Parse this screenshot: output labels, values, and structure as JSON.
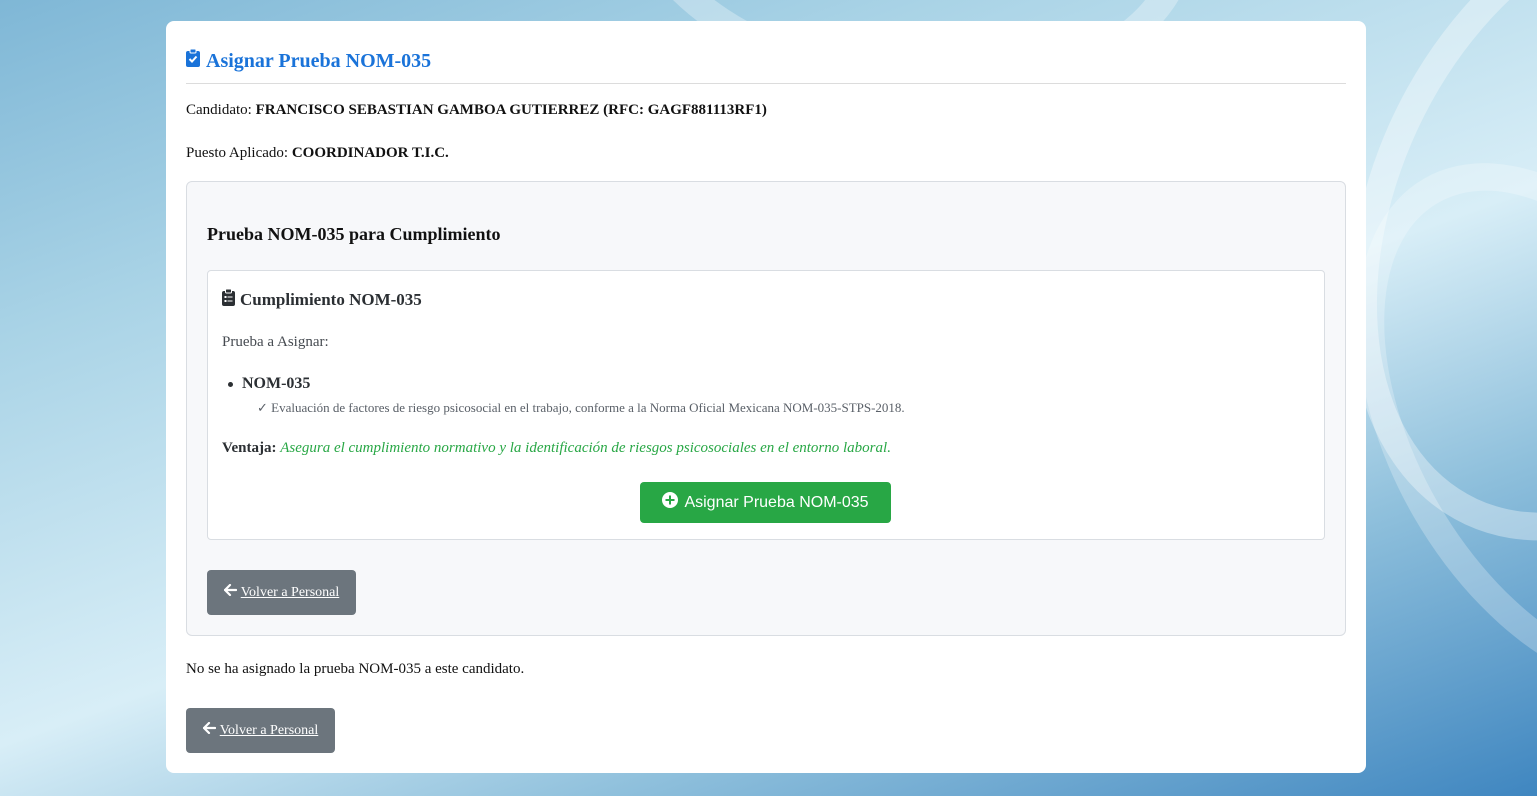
{
  "header": {
    "title": "Asignar Prueba NOM-035"
  },
  "candidate": {
    "label": "Candidato:",
    "value": "FRANCISCO SEBASTIAN GAMBOA GUTIERREZ (RFC: GAGF881113RF1)"
  },
  "position": {
    "label": "Puesto Aplicado:",
    "value": "COORDINADOR T.I.C."
  },
  "panel": {
    "heading": "Prueba NOM-035 para Cumplimiento",
    "card": {
      "title": "Cumplimiento NOM-035",
      "prompt": "Prueba a Asignar:",
      "test_name": "NOM-035",
      "test_desc": "✓ Evaluación de factores de riesgo psicosocial en el trabajo, conforme a la Norma Oficial Mexicana NOM-035-STPS-2018.",
      "advantage_label": "Ventaja:",
      "advantage_text": "Asegura el cumplimiento normativo y la identificación de riesgos psicosociales en el entorno laboral.",
      "assign_button": "Asignar Prueba NOM-035"
    },
    "back_button": "Volver a Personal"
  },
  "status_text": "No se ha asignado la prueba NOM-035 a este candidato.",
  "footer_back_button": "Volver a Personal",
  "colors": {
    "accent": "#1a73d9",
    "success": "#28a745",
    "advantage_text": "#28a745",
    "secondary_button": "#6c757d"
  },
  "icons": {
    "title_icon": "clipboard-check-icon",
    "card_icon": "clipboard-list-icon",
    "assign_icon": "plus-circle-icon",
    "back_icon": "arrow-left-icon"
  }
}
